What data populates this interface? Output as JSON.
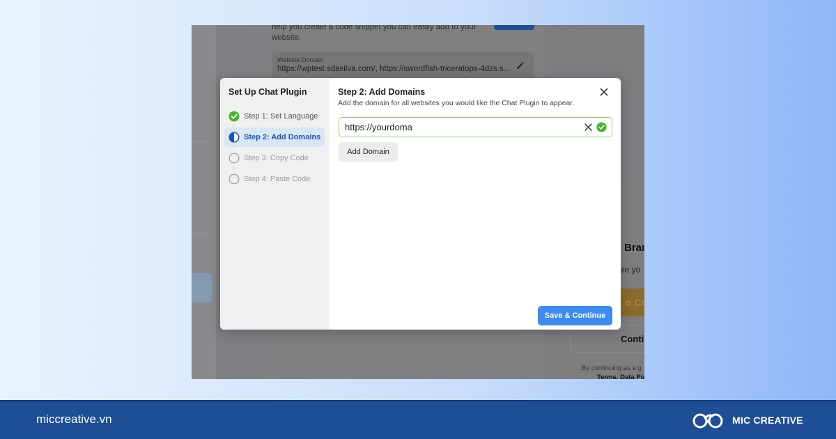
{
  "background": {
    "intro_text": "help you create a code snippet you can easily add to your website.",
    "domain_label": "Website Domain",
    "domain_value": "https://wptest.sdasilva.com/, https://swordfish-triceratops-4dzs.s...",
    "right_title": "Bran",
    "right_text": "are yo",
    "right_button": "o Con",
    "right_continue": "Conti",
    "right_footnote": "By continuing as a g",
    "right_terms": "Terms, Data Po"
  },
  "dialog": {
    "sidebar_title": "Set Up Chat Plugin",
    "steps": [
      {
        "label": "Step 1: Set Language",
        "state": "done"
      },
      {
        "label": "Step 2: Add Domains",
        "state": "active"
      },
      {
        "label": "Step 3: Copy Code",
        "state": "todo"
      },
      {
        "label": "Step 4: Paste Code",
        "state": "todo"
      }
    ],
    "title": "Step 2: Add Domains",
    "subtitle": "Add the domain for all websites you would like the Chat Plugin to appear.",
    "domain_input_value": "https://yourdoma",
    "add_domain_label": "Add Domain",
    "save_label": "Save & Continue"
  },
  "footer": {
    "site": "miccreative.vn",
    "brand": "MIC CREATIVE"
  },
  "colors": {
    "accent": "#3d8af0",
    "active_step": "#1a54b6",
    "success": "#42b72a",
    "footer": "#1e4e96"
  }
}
